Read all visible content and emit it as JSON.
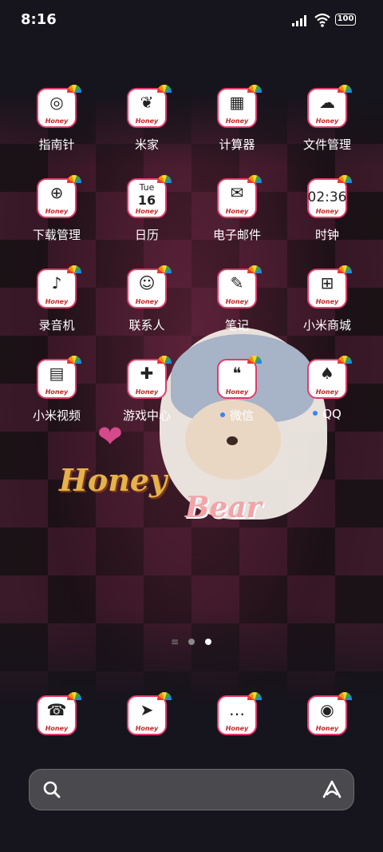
{
  "status_bar": {
    "time": "8:16",
    "battery_level": "100"
  },
  "wallpaper": {
    "word_honey": "Honey",
    "word_bear": "Bear"
  },
  "icon_badge_text": "Honey",
  "apps": [
    {
      "label": "指南针",
      "icon": "compass-icon",
      "glyph": "◎"
    },
    {
      "label": "米家",
      "icon": "mijia-sprout-icon",
      "glyph": "❦"
    },
    {
      "label": "计算器",
      "icon": "calculator-icon",
      "glyph": "▦"
    },
    {
      "label": "文件管理",
      "icon": "cloud-folder-icon",
      "glyph": "☁"
    },
    {
      "label": "下载管理",
      "icon": "download-magnifier-icon",
      "glyph": "⊕"
    },
    {
      "label": "日历",
      "icon": "calendar-icon",
      "day_abbrev": "Tue",
      "day_number": "16"
    },
    {
      "label": "电子邮件",
      "icon": "mail-icon",
      "glyph": "✉"
    },
    {
      "label": "时钟",
      "icon": "clock-icon",
      "time_text": "02:36"
    },
    {
      "label": "录音机",
      "icon": "microphone-icon",
      "glyph": "♪"
    },
    {
      "label": "联系人",
      "icon": "contacts-person-icon",
      "glyph": "☺"
    },
    {
      "label": "笔记",
      "icon": "notes-icon",
      "glyph": "✎"
    },
    {
      "label": "小米商城",
      "icon": "shopping-cart-icon",
      "glyph": "⊞"
    },
    {
      "label": "小米视频",
      "icon": "video-chat-bubble-icon",
      "glyph": "▤"
    },
    {
      "label": "游戏中心",
      "icon": "gamepad-icon",
      "glyph": "✚"
    },
    {
      "label": "微信",
      "icon": "wechat-icon",
      "glyph": "❝"
    },
    {
      "label": "QQ",
      "icon": "qq-penguin-icon",
      "glyph": "♠"
    }
  ],
  "dock": [
    {
      "icon": "phone-icon",
      "glyph": "☎"
    },
    {
      "icon": "browser-icon",
      "glyph": "➤"
    },
    {
      "icon": "messages-icon",
      "glyph": "…"
    },
    {
      "icon": "camera-icon",
      "glyph": "◉"
    }
  ],
  "search": {
    "placeholder": ""
  },
  "colors": {
    "accent_pink": "#e23b6a",
    "notification_dot": "#3b82f6"
  }
}
